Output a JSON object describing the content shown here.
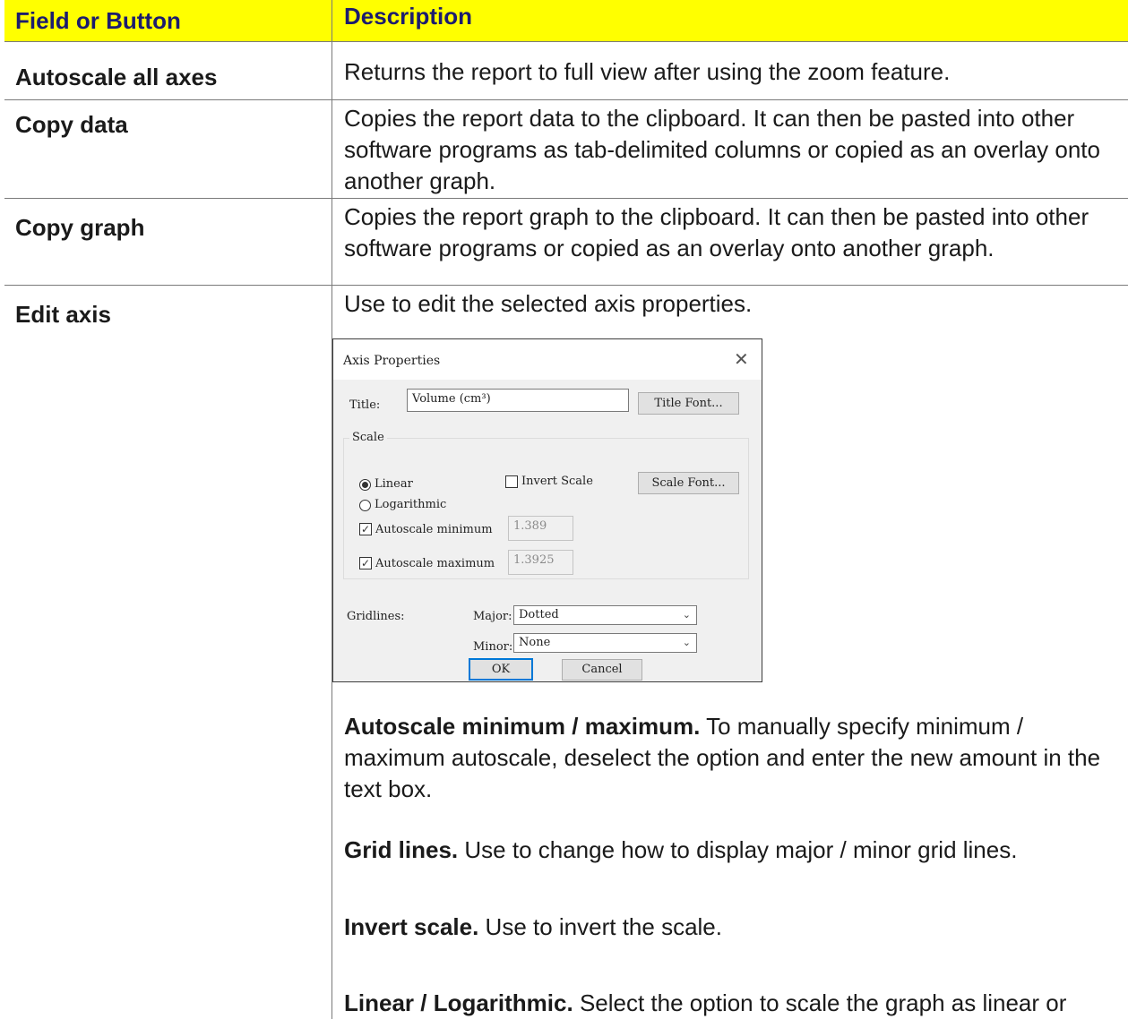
{
  "table": {
    "header_field": "Field or Button",
    "header_desc": "Description",
    "rows": [
      {
        "field": "Autoscale all axes",
        "desc": "Returns the report to full view after using the zoom feature."
      },
      {
        "field": "Copy data",
        "desc": "Copies the report data to the clipboard. It can then be pasted into other software programs as tab-delimited columns or copied as an overlay onto another graph."
      },
      {
        "field": "Copy graph",
        "desc": "Copies the report graph to the clipboard. It can then be pasted into other software programs or copied as an overlay onto another graph."
      },
      {
        "field": "Edit axis",
        "desc": "Use to edit the selected axis properties."
      }
    ]
  },
  "dialog": {
    "title": "Axis Properties",
    "close_glyph": "✕",
    "title_label": "Title:",
    "title_value": "Volume (cm³)",
    "title_font_button": "Title Font...",
    "scale_group": "Scale",
    "linear": "Linear",
    "linear_selected": true,
    "logarithmic": "Logarithmic",
    "invert_scale": "Invert Scale",
    "scale_font_button": "Scale Font...",
    "autoscale_min": "Autoscale minimum",
    "autoscale_min_value": "1.389",
    "autoscale_max": "Autoscale maximum",
    "autoscale_max_value": "1.3925",
    "check_glyph": "✓",
    "gridlines_label": "Gridlines:",
    "major_label": "Major:",
    "major_value": "Dotted",
    "minor_label": "Minor:",
    "minor_value": "None",
    "dropdown_glyph": "⌄",
    "ok": "OK",
    "cancel": "Cancel"
  },
  "notes": [
    {
      "bold": "Autoscale minimum / maximum.",
      "text": " To manually specify minimum / maximum autoscale, deselect the option and enter the new amount in the text box."
    },
    {
      "bold": "Grid lines.",
      "text": " Use to change how to display major / minor grid lines."
    },
    {
      "bold": "Invert scale.",
      "text": " Use to invert the scale."
    },
    {
      "bold": "Linear / Logarithmic.",
      "text": " Select the option to scale the graph as linear or"
    }
  ]
}
